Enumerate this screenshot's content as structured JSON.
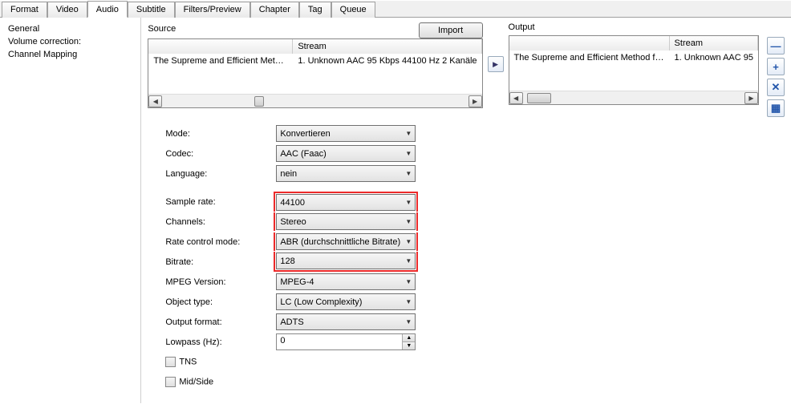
{
  "tabs": {
    "format": "Format",
    "video": "Video",
    "audio": "Audio",
    "subtitle": "Subtitle",
    "filters": "Filters/Preview",
    "chapter": "Chapter",
    "tag": "Tag",
    "queue": "Queue"
  },
  "sidebar": {
    "general": "General",
    "volcorr": "Volume correction:",
    "chmap": "Channel Mapping"
  },
  "source": {
    "title": "Source",
    "import": "Import",
    "col_stream": "Stream",
    "row_name": "The Supreme and Efficient Metho...",
    "row_stream": "1. Unknown AAC  95 Kbps 44100 Hz 2 Kanäle"
  },
  "output": {
    "title": "Output",
    "col_stream": "Stream",
    "row_name": "The Supreme and Efficient Method fo...",
    "row_stream": "1. Unknown AAC  95"
  },
  "form": {
    "mode": {
      "label": "Mode:",
      "value": "Konvertieren"
    },
    "codec": {
      "label": "Codec:",
      "value": "AAC (Faac)"
    },
    "language": {
      "label": "Language:",
      "value": "nein"
    },
    "samplerate": {
      "label": "Sample rate:",
      "value": "44100"
    },
    "channels": {
      "label": "Channels:",
      "value": "Stereo"
    },
    "ratectrl": {
      "label": "Rate control mode:",
      "value": "ABR (durchschnittliche Bitrate)"
    },
    "bitrate": {
      "label": "Bitrate:",
      "value": "128"
    },
    "mpeg": {
      "label": "MPEG Version:",
      "value": "MPEG-4"
    },
    "objtype": {
      "label": "Object type:",
      "value": "LC (Low Complexity)"
    },
    "outfmt": {
      "label": "Output format:",
      "value": "ADTS"
    },
    "lowpass": {
      "label": "Lowpass (Hz):",
      "value": "0"
    },
    "tns": "TNS",
    "midside": "Mid/Side"
  },
  "icons": {
    "minus": "—",
    "plus": "+",
    "x": "✕",
    "grid": "▦",
    "right": "▶",
    "left": "◀",
    "up": "▲",
    "down": "▼"
  }
}
